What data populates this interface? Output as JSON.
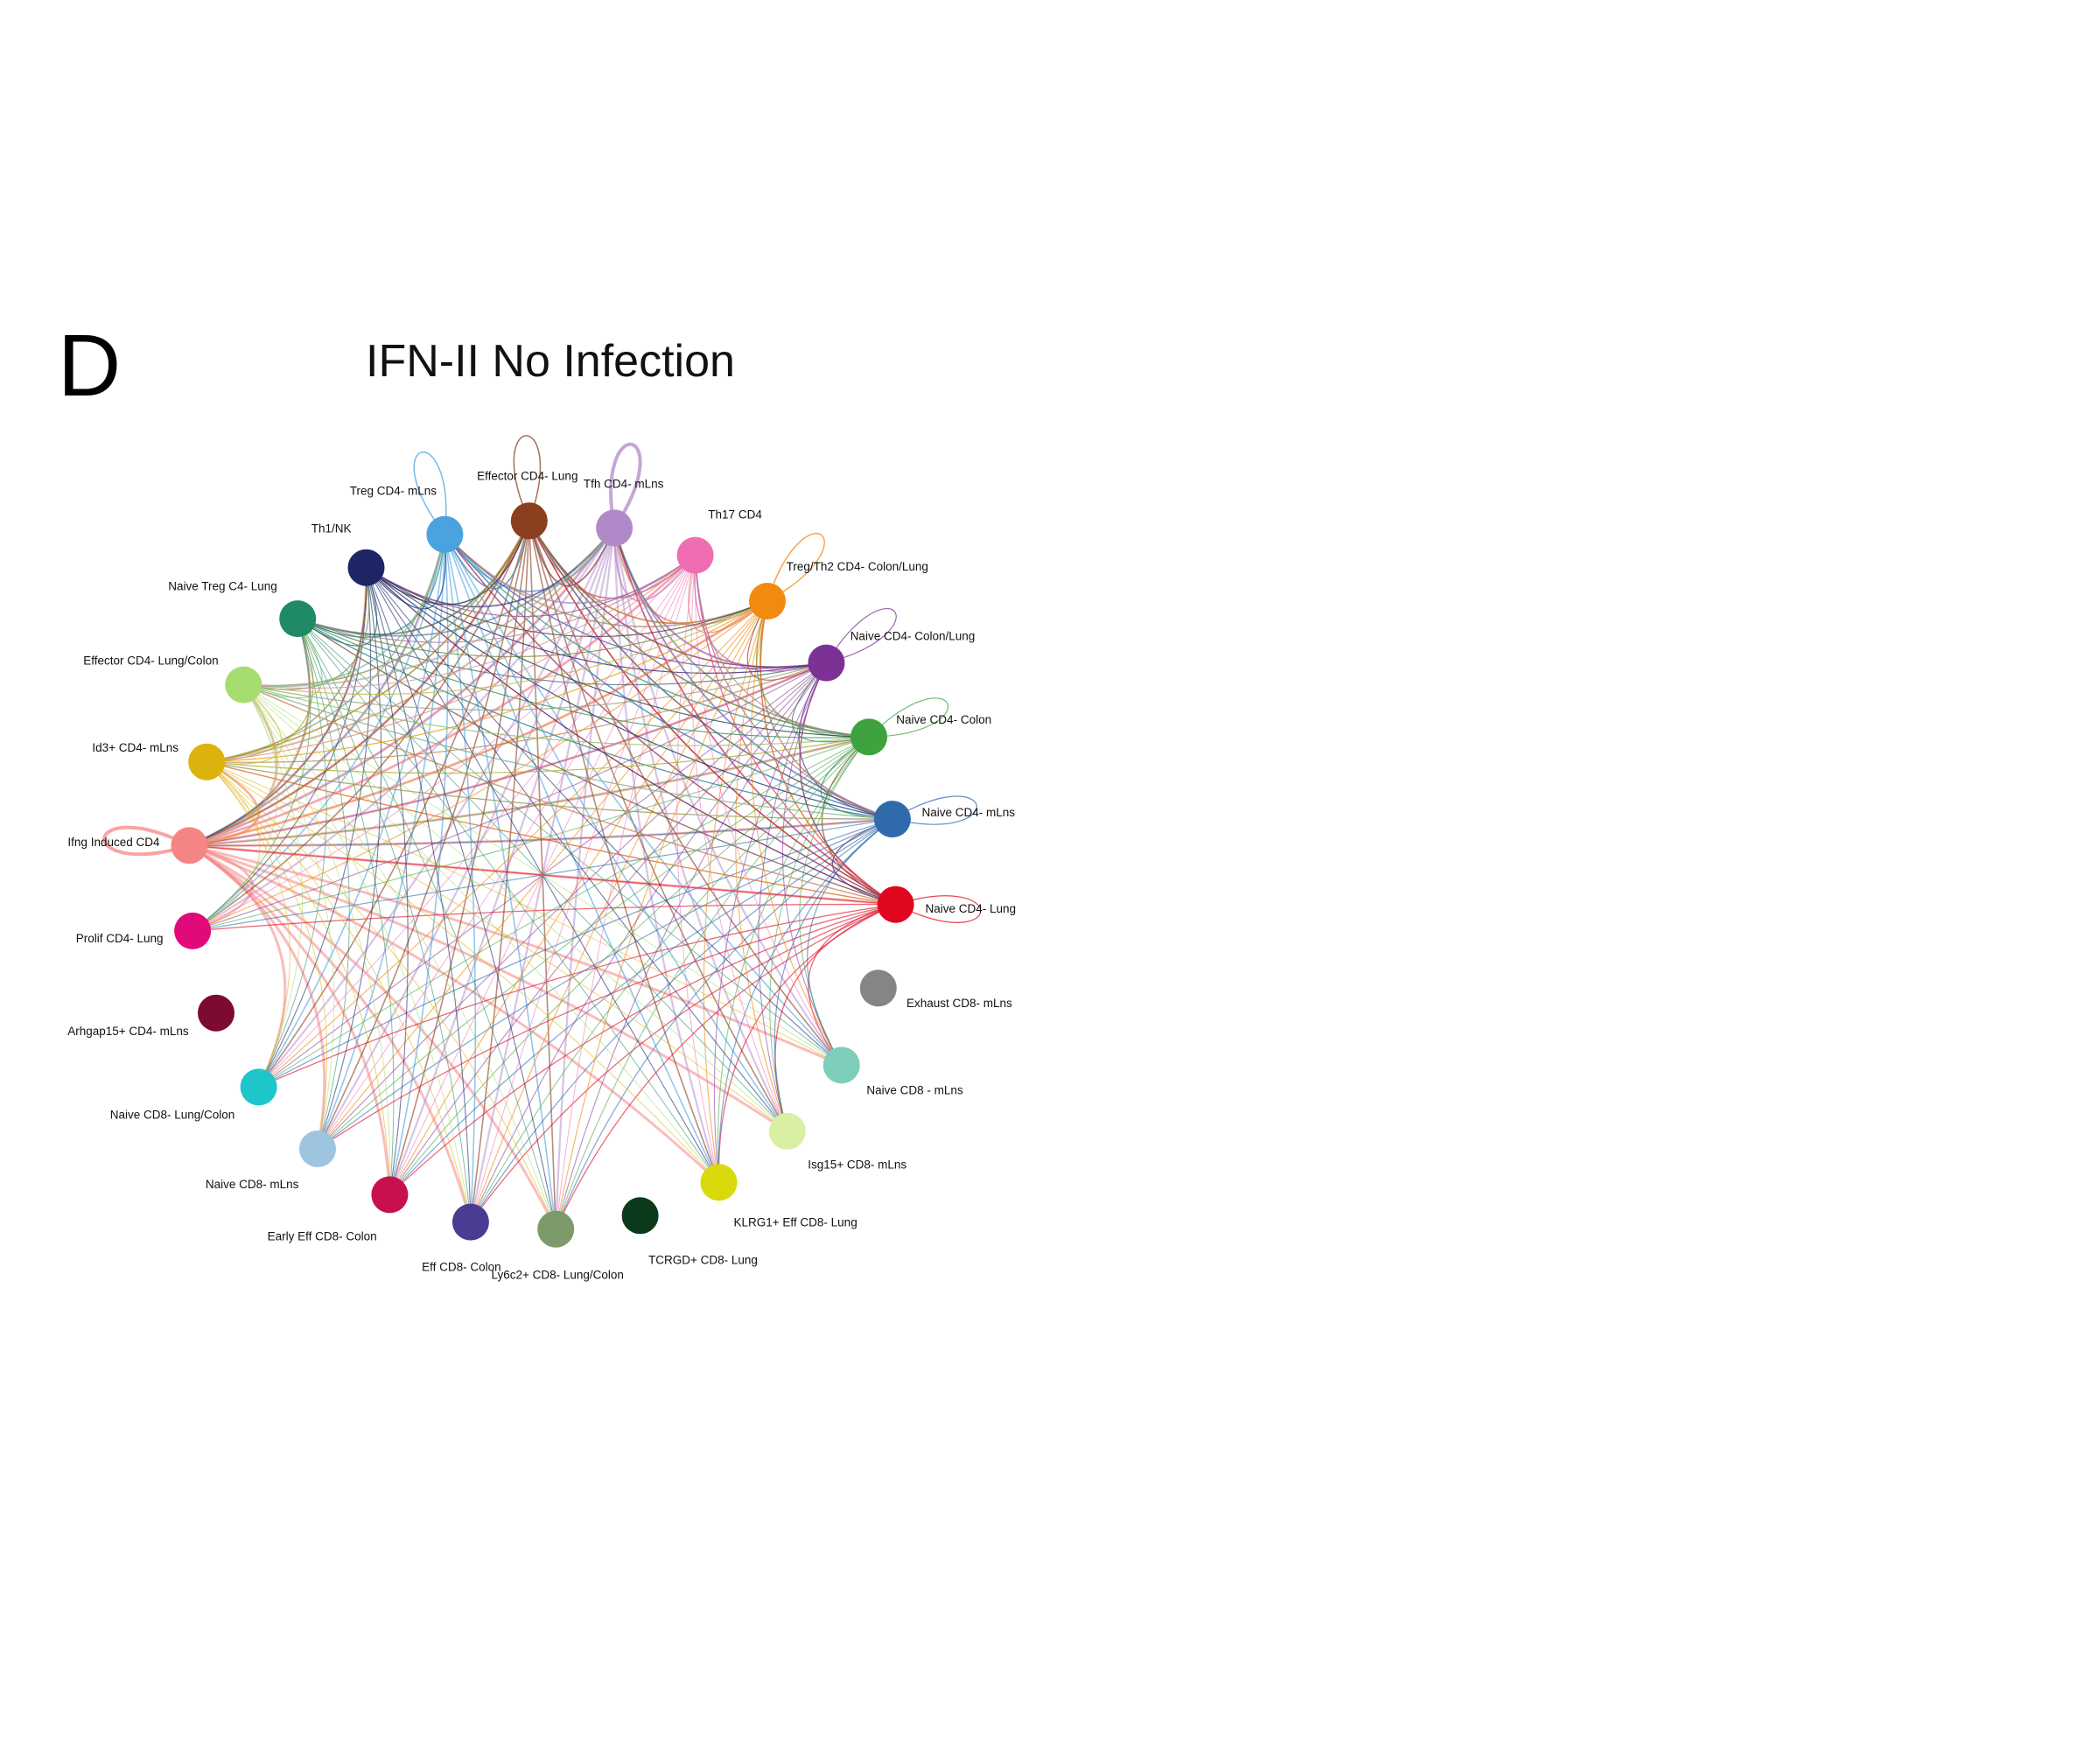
{
  "panel_letter": "D",
  "title": "IFN-II No Infection",
  "nodes": [
    {
      "id": "treg_cd4_mlns",
      "label": "Treg CD4- mLns",
      "color": "#4aa3df"
    },
    {
      "id": "effector_cd4_lung",
      "label": "Effector CD4- Lung",
      "color": "#8b3f1e"
    },
    {
      "id": "tfh_cd4_mlns",
      "label": "Tfh CD4- mLns",
      "color": "#b08ac8"
    },
    {
      "id": "th17_cd4",
      "label": "Th17 CD4",
      "color": "#f06db3"
    },
    {
      "id": "treg_th2_cd4_colon_lung",
      "label": "Treg/Th2 CD4- Colon/Lung",
      "color": "#f28a10"
    },
    {
      "id": "naive_cd4_colon_lung",
      "label": "Naive CD4- Colon/Lung",
      "color": "#7b3294"
    },
    {
      "id": "naive_cd4_colon",
      "label": "Naive CD4- Colon",
      "color": "#3ea33e"
    },
    {
      "id": "naive_cd4_mlns",
      "label": "Naive CD4- mLns",
      "color": "#2f6aab"
    },
    {
      "id": "naive_cd4_lung",
      "label": "Naive CD4- Lung",
      "color": "#e0061e"
    },
    {
      "id": "exhaust_cd8_mlns",
      "label": "Exhaust CD8- mLns",
      "color": "#858585"
    },
    {
      "id": "naive_cd8_mlns_r",
      "label": "Naive CD8 - mLns",
      "color": "#7fcdbb"
    },
    {
      "id": "isg15_cd8_mlns",
      "label": "Isg15+ CD8- mLns",
      "color": "#d9f0a3"
    },
    {
      "id": "klrg1_eff_cd8_lung",
      "label": "KLRG1+ Eff CD8- Lung",
      "color": "#d9d90b"
    },
    {
      "id": "tcrgd_cd8_lung",
      "label": "TCRGD+ CD8- Lung",
      "color": "#0b3a1a"
    },
    {
      "id": "ly6c2_cd8_lung_colon",
      "label": "Ly6c2+ CD8- Lung/Colon",
      "color": "#7d9a6a"
    },
    {
      "id": "eff_cd8_colon",
      "label": "Eff CD8- Colon",
      "color": "#4a3b93"
    },
    {
      "id": "early_eff_cd8_colon",
      "label": "Early Eff CD8- Colon",
      "color": "#c8104e"
    },
    {
      "id": "naive_cd8_mlns_l",
      "label": "Naive CD8- mLns",
      "color": "#9ec5e0"
    },
    {
      "id": "naive_cd8_lung_colon",
      "label": "Naive CD8- Lung/Colon",
      "color": "#1ec6cc"
    },
    {
      "id": "arhgap15_cd4_mlns",
      "label": "Arhgap15+ CD4- mLns",
      "color": "#7c0a33"
    },
    {
      "id": "prolif_cd4_lung",
      "label": "Prolif CD4- Lung",
      "color": "#e20a7b"
    },
    {
      "id": "ifng_induced_cd4",
      "label": "Ifng Induced CD4",
      "color": "#f58585"
    },
    {
      "id": "id3_cd4_mlns",
      "label": "Id3+ CD4- mLns",
      "color": "#dcb30c"
    },
    {
      "id": "effector_cd4_lung_colon",
      "label": "Effector CD4- Lung/Colon",
      "color": "#a6dd70"
    },
    {
      "id": "naive_treg_c4_lung",
      "label": "Naive Treg C4- Lung",
      "color": "#1f8a63"
    },
    {
      "id": "th1_nk",
      "label": "Th1/NK",
      "color": "#1d2565"
    }
  ],
  "self_loops": [
    {
      "node": "treg_cd4_mlns",
      "weight": 1.5
    },
    {
      "node": "effector_cd4_lung",
      "weight": 1.5
    },
    {
      "node": "tfh_cd4_mlns",
      "weight": 4
    },
    {
      "node": "treg_th2_cd4_colon_lung",
      "weight": 1.5
    },
    {
      "node": "naive_cd4_colon_lung",
      "weight": 1.2
    },
    {
      "node": "naive_cd4_colon",
      "weight": 1.2
    },
    {
      "node": "naive_cd4_mlns",
      "weight": 1.2
    },
    {
      "node": "naive_cd4_lung",
      "weight": 1.2
    },
    {
      "node": "ifng_induced_cd4",
      "weight": 4
    }
  ],
  "sources": [
    {
      "node": "ifng_induced_cd4",
      "weight": 3,
      "opacity": 0.55
    },
    {
      "node": "tfh_cd4_mlns",
      "weight": 2.2,
      "opacity": 0.5
    },
    {
      "node": "effector_cd4_lung",
      "weight": 1.6,
      "opacity": 0.6
    },
    {
      "node": "treg_cd4_mlns",
      "weight": 1.6,
      "opacity": 0.6
    },
    {
      "node": "naive_cd4_lung",
      "weight": 1.3,
      "opacity": 0.6
    },
    {
      "node": "naive_cd4_mlns",
      "weight": 1.2,
      "opacity": 0.6
    },
    {
      "node": "treg_th2_cd4_colon_lung",
      "weight": 1.2,
      "opacity": 0.6
    },
    {
      "node": "naive_cd4_colon_lung",
      "weight": 1.1,
      "opacity": 0.55
    },
    {
      "node": "naive_cd4_colon",
      "weight": 1.1,
      "opacity": 0.55
    },
    {
      "node": "th1_nk",
      "weight": 1.1,
      "opacity": 0.6
    },
    {
      "node": "naive_treg_c4_lung",
      "weight": 1.0,
      "opacity": 0.55
    },
    {
      "node": "effector_cd4_lung_colon",
      "weight": 1.0,
      "opacity": 0.55
    },
    {
      "node": "id3_cd4_mlns",
      "weight": 1.0,
      "opacity": 0.55
    },
    {
      "node": "th17_cd4",
      "weight": 1.0,
      "opacity": 0.55
    }
  ],
  "targets": [
    "treg_cd4_mlns",
    "effector_cd4_lung",
    "tfh_cd4_mlns",
    "th17_cd4",
    "treg_th2_cd4_colon_lung",
    "naive_cd4_colon_lung",
    "naive_cd4_colon",
    "naive_cd4_mlns",
    "naive_cd4_lung",
    "ifng_induced_cd4",
    "id3_cd4_mlns",
    "effector_cd4_lung_colon",
    "naive_treg_c4_lung",
    "th1_nk",
    "naive_cd8_lung_colon",
    "naive_cd8_mlns_l",
    "early_eff_cd8_colon",
    "eff_cd8_colon",
    "ly6c2_cd8_lung_colon",
    "klrg1_eff_cd8_lung",
    "isg15_cd8_mlns",
    "naive_cd8_mlns_r",
    "prolif_cd4_lung"
  ]
}
